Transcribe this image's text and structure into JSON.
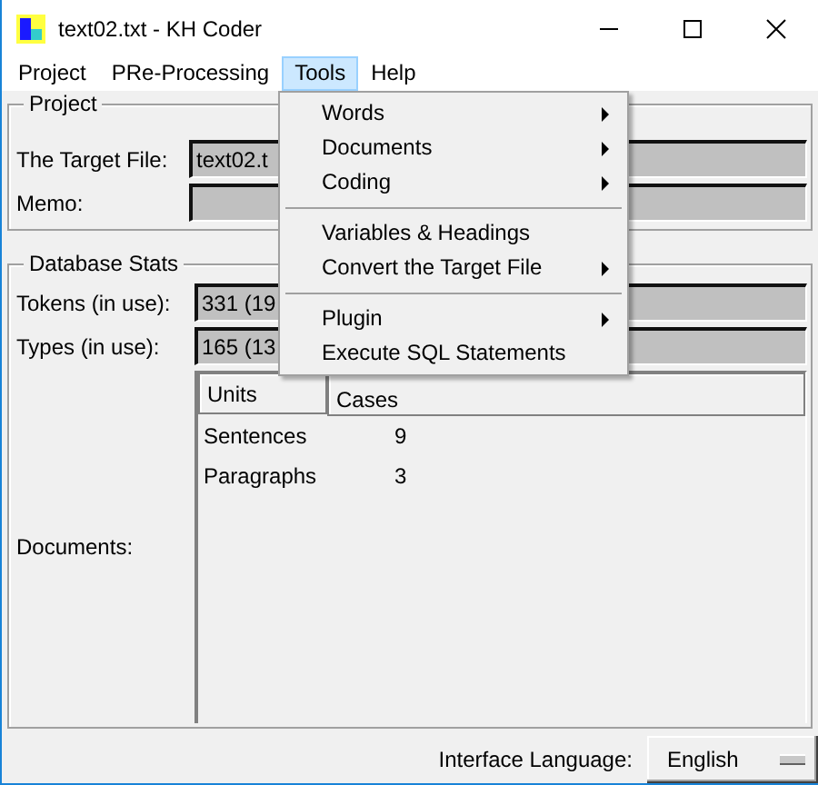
{
  "window": {
    "title": "text02.txt - KH Coder"
  },
  "menu_bar": [
    {
      "label": "Project",
      "selected": false
    },
    {
      "label": "PRe-Processing",
      "selected": false
    },
    {
      "label": "Tools",
      "selected": true
    },
    {
      "label": "Help",
      "selected": false
    }
  ],
  "tools_menu": [
    {
      "kind": "item",
      "label": "Words",
      "submenu": true
    },
    {
      "kind": "item",
      "label": "Documents",
      "submenu": true
    },
    {
      "kind": "item",
      "label": "Coding",
      "submenu": true
    },
    {
      "kind": "separator"
    },
    {
      "kind": "item",
      "label": "Variables & Headings",
      "submenu": false
    },
    {
      "kind": "item",
      "label": "Convert the Target File",
      "submenu": true
    },
    {
      "kind": "separator"
    },
    {
      "kind": "item",
      "label": "Plugin",
      "submenu": true
    },
    {
      "kind": "item",
      "label": "Execute SQL Statements",
      "submenu": false
    }
  ],
  "project": {
    "title": "Project",
    "fields": [
      {
        "label": "The Target File:",
        "value": "text02.t"
      },
      {
        "label": "Memo:"
      }
    ]
  },
  "database_stats": {
    "title": "Database Stats",
    "fields": [
      {
        "label": "Tokens (in use):",
        "value": "331 (19"
      },
      {
        "label": "Types (in use):",
        "value": "165 (13"
      }
    ],
    "documents": {
      "label": "Documents:",
      "columns": [
        "Units",
        "Cases"
      ],
      "rows": [
        [
          "Sentences",
          "9"
        ],
        [
          "Paragraphs",
          "3"
        ]
      ]
    }
  },
  "status_bar": {
    "label": "Interface Language:",
    "language": "English"
  }
}
